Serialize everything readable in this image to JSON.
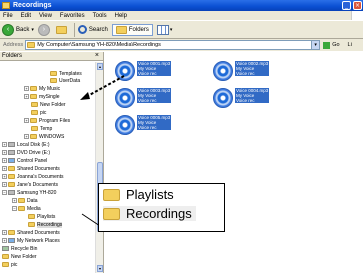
{
  "window": {
    "title": "Recordings"
  },
  "menu": [
    "File",
    "Edit",
    "View",
    "Favorites",
    "Tools",
    "Help"
  ],
  "toolbar": {
    "back": "Back",
    "search": "Search",
    "folders": "Folders"
  },
  "address": {
    "label": "Address",
    "path": "My Computer\\Samsung YH-820\\Media\\Recordings",
    "go": "Go",
    "links": "Li"
  },
  "folders_pane": {
    "title": "Folders",
    "nodes": [
      "Templates",
      "UserData",
      "My Music",
      "mySingle",
      "New Folder",
      "pic",
      "Program Files",
      "Temp",
      "WINDOWS",
      "Local Disk (E:)",
      "DVD Drive (E:)",
      "Control Panel",
      "Shared Documents",
      "Joanna's Documents",
      "Jane's Documents",
      "Samsung YH-820",
      "Data",
      "Media",
      "Playlists",
      "Recordings",
      "Shared Documents",
      "My Network Places",
      "Recycle Bin",
      "New Folder",
      "pic"
    ]
  },
  "files": [
    {
      "name": "Voice 0001.mp3",
      "l2": "My Voice",
      "l3": "Voice rec"
    },
    {
      "name": "Voice 0002.mp3",
      "l2": "My Voice",
      "l3": "Voice rec"
    },
    {
      "name": "Voice 0003.mp3",
      "l2": "My Voice",
      "l3": "Voice rec"
    },
    {
      "name": "Voice 0004.mp3",
      "l2": "My Voice",
      "l3": "Voice rec"
    },
    {
      "name": "Voice 0005.mp3",
      "l2": "My Voice",
      "l3": "Voice rec"
    }
  ],
  "callout": {
    "playlists": "Playlists",
    "recordings": "Recordings"
  },
  "colors": {
    "title_bar": "#0a4fd2",
    "selection": "#316ac5",
    "folder": "#f3cf5d"
  }
}
